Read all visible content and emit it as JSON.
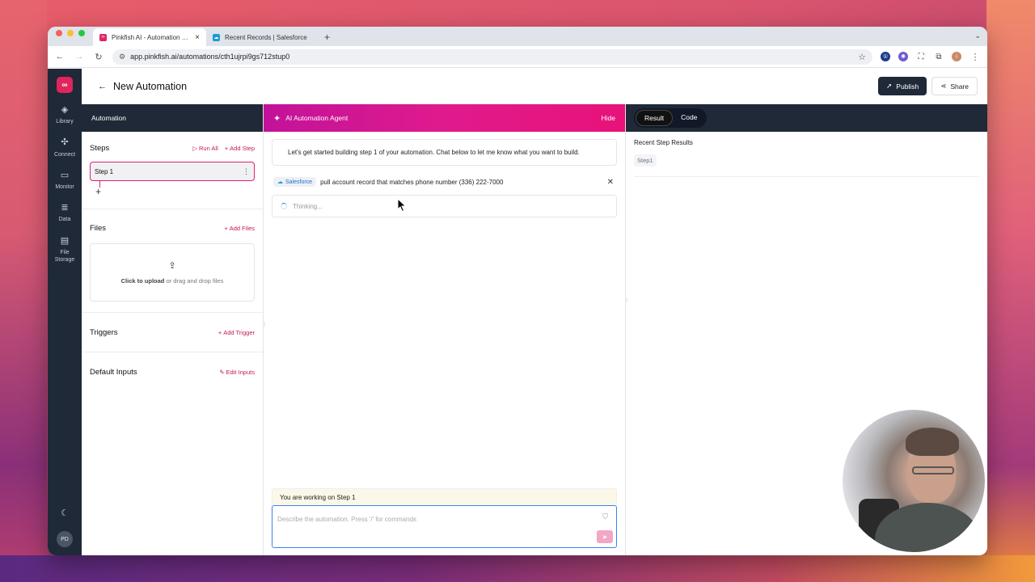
{
  "browser": {
    "tabs": [
      {
        "title": "Pinkfish AI - Automation made",
        "favicon": "pinkfish-logo-icon",
        "active": true
      },
      {
        "title": "Recent Records | Salesforce",
        "favicon": "salesforce-cloud-icon",
        "active": false
      }
    ],
    "new_tab_symbol": "+",
    "url": "app.pinkfish.ai/automations/cth1ujrpi9gs712stup0"
  },
  "rail": {
    "logo_text": "∞",
    "items": [
      {
        "label": "Library",
        "icon": "layers-icon"
      },
      {
        "label": "Connect",
        "icon": "puzzle-icon"
      },
      {
        "label": "Monitor",
        "icon": "monitor-icon"
      },
      {
        "label": "Data",
        "icon": "database-icon"
      },
      {
        "label": "File Storage",
        "icon": "file-icon"
      }
    ],
    "avatar_initials": "PD"
  },
  "topbar": {
    "title": "New Automation",
    "publish_label": "Publish",
    "share_label": "Share"
  },
  "left": {
    "header": "Automation",
    "steps": {
      "title": "Steps",
      "run_all": "Run All",
      "add_step": "Add Step",
      "items": [
        "Step 1"
      ]
    },
    "files": {
      "title": "Files",
      "add_files": "Add Files",
      "upload_bold": "Click to upload",
      "upload_rest": " or drag and drop files"
    },
    "triggers": {
      "title": "Triggers",
      "add_trigger": "Add Trigger"
    },
    "inputs": {
      "title": "Default Inputs",
      "edit_inputs": "Edit Inputs"
    }
  },
  "agent": {
    "header": "AI Automation Agent",
    "hide_label": "Hide",
    "intro_message": "Let's get started building step 1 of your automation. Chat below to let me know what you want to build.",
    "user_badge": "Salesforce",
    "user_message": "pull account record that matches phone number (336) 222-7000",
    "thinking": "Thinking...",
    "working_on": "You are working on Step 1",
    "input_placeholder": "Describe the automation. Press '/' for commands"
  },
  "right": {
    "tabs": [
      "Result",
      "Code"
    ],
    "active_tab": "Result",
    "results_title": "Recent Step Results",
    "step_pill": "Step1"
  },
  "colors": {
    "accent_pink": "#e11d74",
    "sidebar_dark": "#1f2937",
    "agent_gradient_start": "#c2129a",
    "agent_gradient_end": "#e8127a"
  }
}
